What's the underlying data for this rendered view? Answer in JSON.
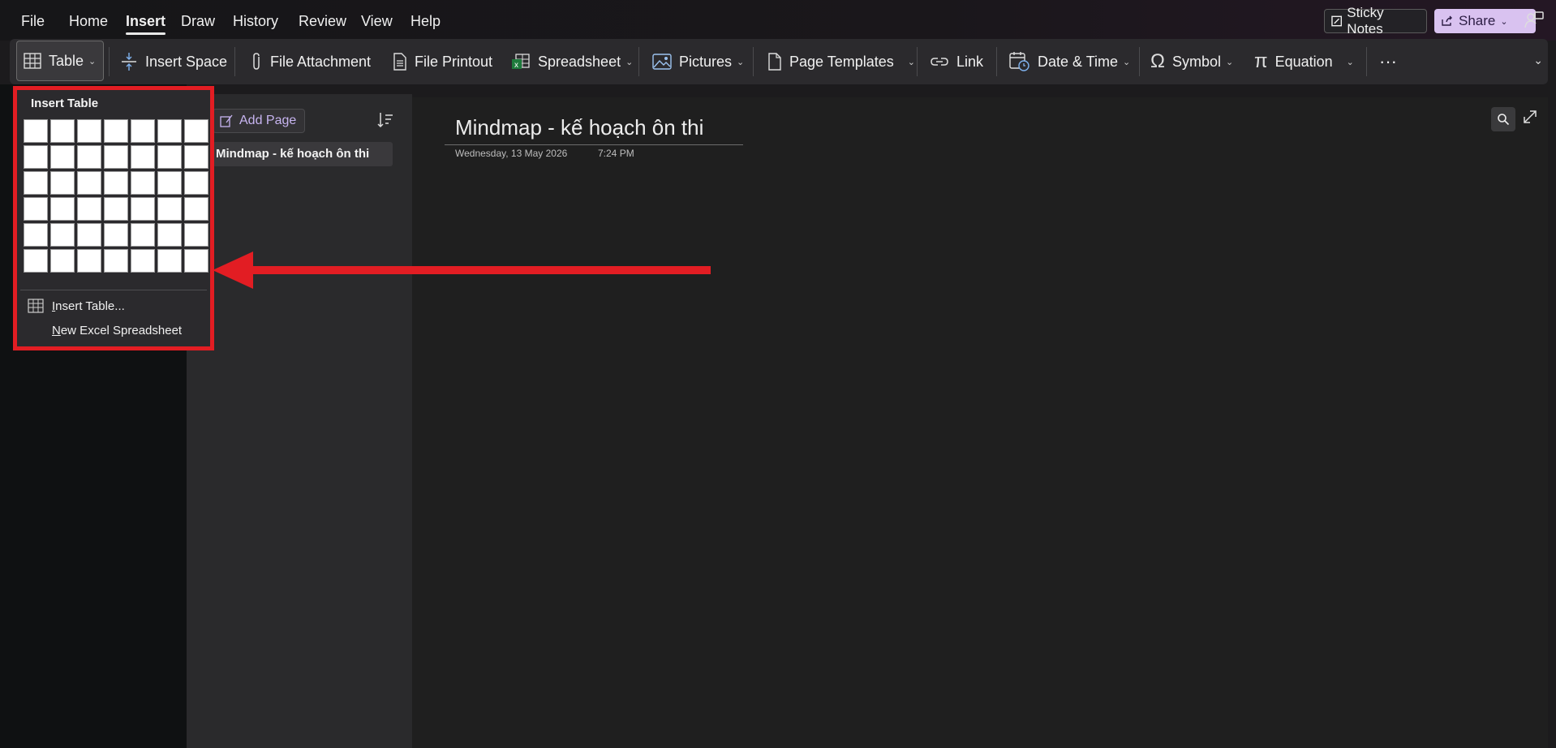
{
  "menu": {
    "items": [
      "File",
      "Home",
      "Insert",
      "Draw",
      "History",
      "Review",
      "View",
      "Help"
    ],
    "active": "Insert",
    "sticky_notes": "Sticky Notes",
    "share": "Share"
  },
  "ribbon": {
    "table": "Table",
    "insert_space": "Insert Space",
    "file_attachment": "File Attachment",
    "file_printout": "File Printout",
    "spreadsheet": "Spreadsheet",
    "pictures": "Pictures",
    "page_templates": "Page Templates",
    "link": "Link",
    "date_time": "Date & Time",
    "symbol": "Symbol",
    "equation": "Equation",
    "more": "···"
  },
  "dropdown": {
    "title": "Insert Table",
    "grid_cols": 7,
    "grid_rows": 6,
    "insert_table_prefix": "I",
    "insert_table_rest": "nsert Table...",
    "excel_prefix": "N",
    "excel_rest": "ew Excel Spreadsheet"
  },
  "pages": {
    "add_page": "Add Page",
    "items": [
      "Mindmap - kế hoạch ôn thi"
    ]
  },
  "note": {
    "title": "Mindmap - kế hoạch ôn thi",
    "date": "Wednesday, 13 May 2026",
    "time": "7:24 PM"
  },
  "colors": {
    "annotation": "#e21d23",
    "accent": "#d9c2f0"
  }
}
